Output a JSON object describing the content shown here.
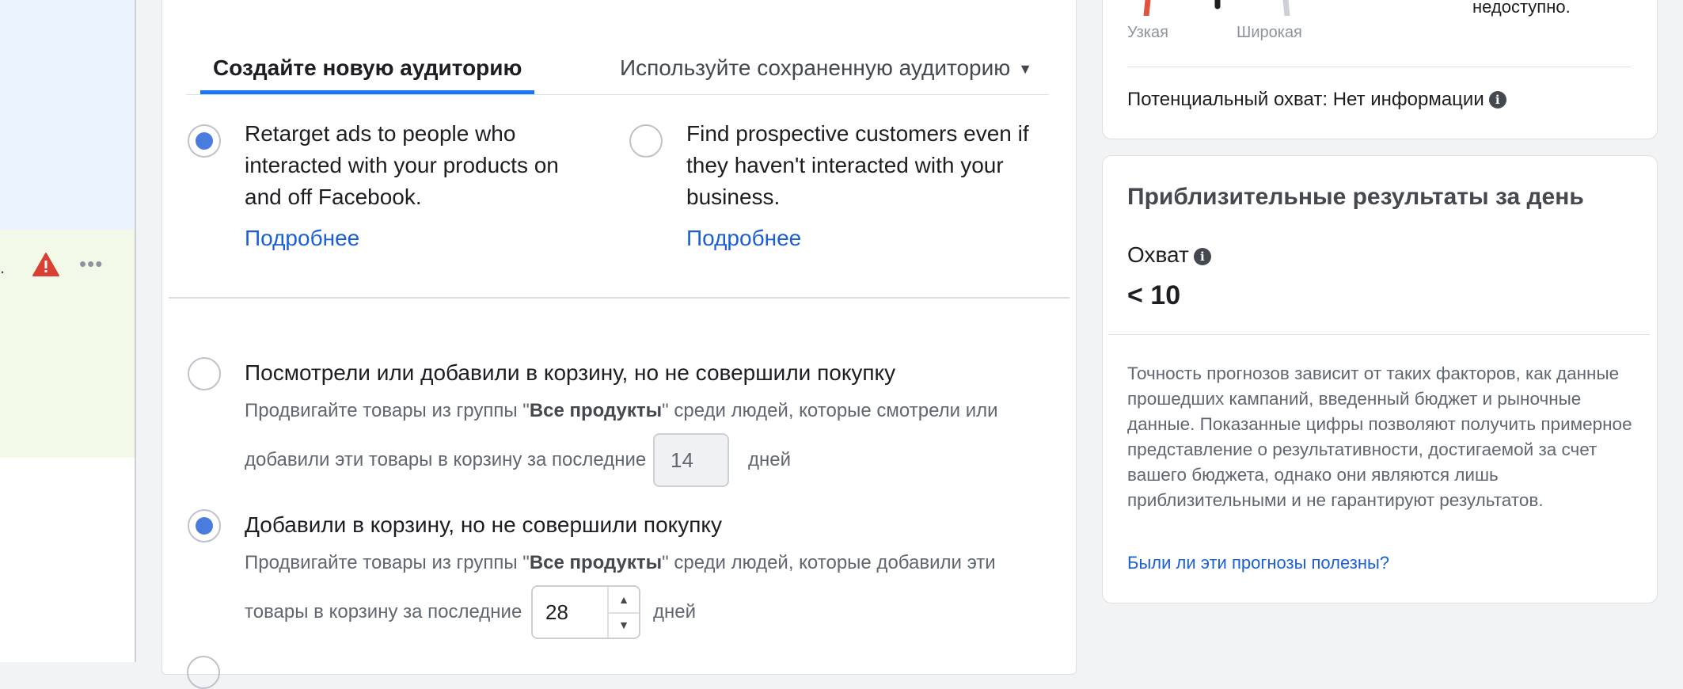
{
  "left_panel": {
    "truncated_text": ".",
    "warning_icon": "warning-triangle-icon",
    "more_icon": "more-horizontal-icon"
  },
  "tabs": {
    "new_audience": "Создайте новую аудиторию",
    "saved_audience": "Используйте сохраненную аудиторию"
  },
  "targeting_options": [
    {
      "text": "Retarget ads to people who interacted with your products on and off Facebook.",
      "link": "Подробнее",
      "selected": true
    },
    {
      "text": "Find prospective customers even if they haven't interacted with your business.",
      "link": "Подробнее",
      "selected": false
    }
  ],
  "audiences": [
    {
      "title": "Посмотрели или добавили в корзину, но не совершили покупку",
      "desc_before": "Продвигайте товары из группы \"",
      "desc_bold": "Все продукты",
      "desc_after": "\" среди людей, которые смотрели или",
      "desc_line2": "добавили эти товары в корзину за последние",
      "days_value": "14",
      "days_label": "дней",
      "selected": false,
      "editable": false
    },
    {
      "title": "Добавили в корзину, но не совершили покупку",
      "desc_before": "Продвигайте товары из группы \"",
      "desc_bold": "Все продукты",
      "desc_after": "\" среди людей, которые добавили эти",
      "desc_line2": "товары в корзину за последние",
      "days_value": "28",
      "days_label": "дней",
      "selected": true,
      "editable": true
    }
  ],
  "audience_size": {
    "narrow_label": "Узкая",
    "wide_label": "Широкая",
    "unavailable_text": "недоступно.",
    "potential_reach": "Потенциальный охват: Нет информации"
  },
  "daily_results": {
    "title": "Приблизительные результаты за день",
    "reach_label": "Охват",
    "reach_value": "< 10",
    "disclaimer": "Точность прогнозов зависит от таких факторов, как данные прошедших кампаний, введенный бюджет и рыночные данные. Показанные цифры позволяют получить примерное представление о результативности, достигаемой за счет вашего бюджета, однако они являются лишь приблизительными и не гарантируют результатов.",
    "feedback_link": "Были ли эти прогнозы полезны?"
  },
  "colors": {
    "accent": "#1877f2",
    "radio_checked": "#4a7ce0",
    "link": "#1a5fd7",
    "warning": "#d93f33",
    "gauge_narrow": "#e0543f"
  }
}
